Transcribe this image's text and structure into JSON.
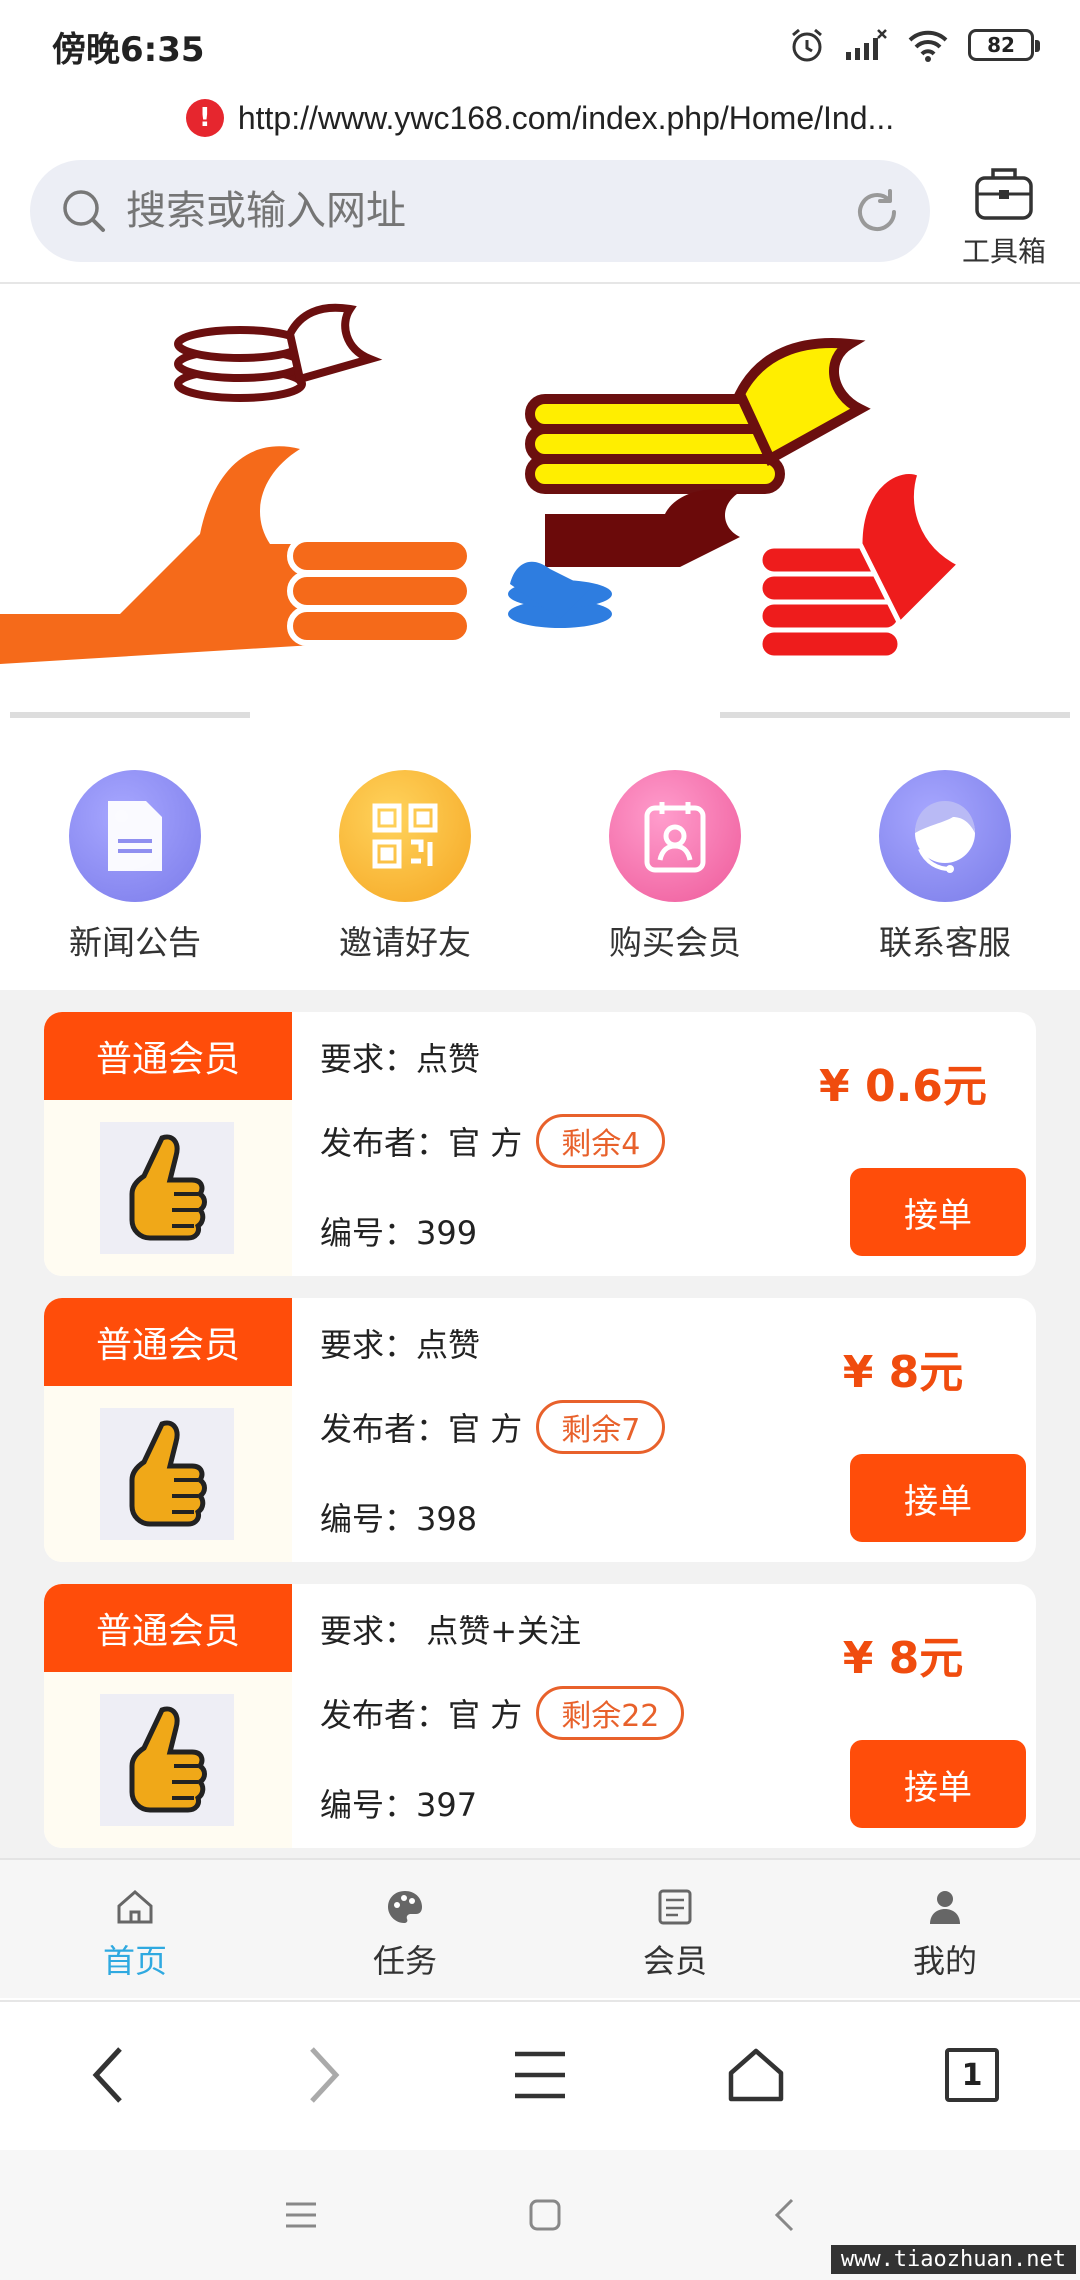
{
  "status": {
    "time": "傍晚6:35",
    "battery": "82"
  },
  "browser": {
    "url": "http://www.ywc168.com/index.php/Home/Ind...",
    "search_placeholder": "搜索或输入网址",
    "toolbox_label": "工具箱",
    "tab_count": "1"
  },
  "quick_menu": [
    {
      "label": "新闻公告",
      "icon": "document-icon",
      "color": "#8f8ff0"
    },
    {
      "label": "邀请好友",
      "icon": "qr-code-icon",
      "color": "#f7b52a"
    },
    {
      "label": "购买会员",
      "icon": "member-card-icon",
      "color": "#f36ea8"
    },
    {
      "label": "联系客服",
      "icon": "customer-service-icon",
      "color": "#8a8cf0"
    }
  ],
  "tasks": [
    {
      "tag": "普通会员",
      "req_label": "要求：",
      "requirement": "点赞",
      "publisher_label": "发布者：",
      "publisher": "官 方",
      "remain": "剩余4",
      "id_label": "编号：",
      "id": "399",
      "price": "¥ 0.6元",
      "button": "接单"
    },
    {
      "tag": "普通会员",
      "req_label": "要求：",
      "requirement": "点赞",
      "publisher_label": "发布者：",
      "publisher": "官 方",
      "remain": "剩余7",
      "id_label": "编号：",
      "id": "398",
      "price": "¥ 8元",
      "button": "接单"
    },
    {
      "tag": "普通会员",
      "req_label": "要求：",
      "requirement": " 点赞+关注",
      "publisher_label": "发布者：",
      "publisher": "官 方",
      "remain": "剩余22",
      "id_label": "编号：",
      "id": "397",
      "price": "¥ 8元",
      "button": "接单"
    }
  ],
  "tabs": [
    {
      "label": "首页",
      "icon": "home-icon",
      "active": true
    },
    {
      "label": "任务",
      "icon": "palette-icon",
      "active": false
    },
    {
      "label": "会员",
      "icon": "member-icon",
      "active": false
    },
    {
      "label": "我的",
      "icon": "user-icon",
      "active": false
    }
  ],
  "watermark": "www.tiaozhuan.net",
  "colors": {
    "accent": "#ff4d0a",
    "active_tab": "#2fa9e0"
  }
}
